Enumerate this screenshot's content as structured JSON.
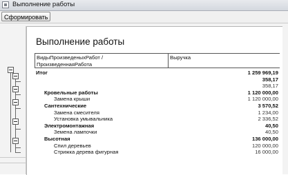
{
  "window": {
    "title": "Выполнение работы"
  },
  "toolbar": {
    "generate_label": "Сформировать"
  },
  "report": {
    "title": "Выполнение работы",
    "columns": {
      "work_line1": "ВидыПроизведеныхРабот /",
      "work_line2": "ПроизведеннаяРабота",
      "revenue": "Выручка"
    },
    "rows": [
      {
        "label": "Итог",
        "value": "1 259 969,19"
      },
      {
        "label": "",
        "value": "358,17"
      },
      {
        "label": "",
        "value": "358,17"
      },
      {
        "label": "Кровельные работы",
        "value": "1 120 000,00"
      },
      {
        "label": "Замена крыши",
        "value": "1 120 000,00"
      },
      {
        "label": "Сантехнические",
        "value": "3 570,52"
      },
      {
        "label": "Замена смесителя",
        "value": "1 234,00"
      },
      {
        "label": "Установка умывальника",
        "value": "2 336,52"
      },
      {
        "label": "Электромонтажная",
        "value": "40,50"
      },
      {
        "label": "Земена лампочки",
        "value": "40,50"
      },
      {
        "label": "Высотная",
        "value": "136 000,00"
      },
      {
        "label": "Спил деревьев",
        "value": "120 000,00"
      },
      {
        "label": "Стрижка дерева фигурная",
        "value": "16 000,00"
      }
    ]
  }
}
